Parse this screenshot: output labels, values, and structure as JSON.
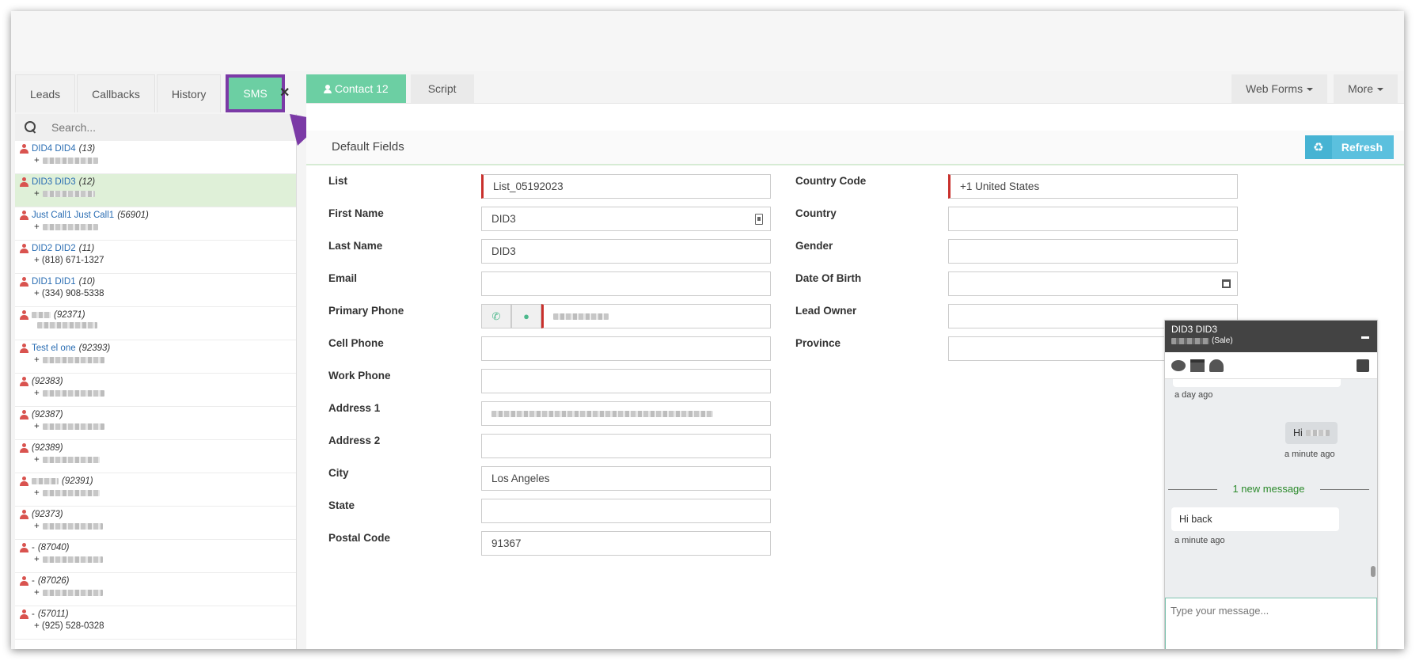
{
  "left_tabs": [
    "Leads",
    "Callbacks",
    "History",
    "SMS"
  ],
  "search": {
    "placeholder": "Search..."
  },
  "leads": [
    {
      "name": "DID4 DID4",
      "id": "(13)",
      "phone": "+"
    },
    {
      "name": "DID3 DID3",
      "id": "(12)",
      "phone": "+"
    },
    {
      "name": "Just Call1 Just Call1",
      "id": "(56901)",
      "phone": "+"
    },
    {
      "name": "DID2 DID2",
      "id": "(11)",
      "phone": "+ (818) 671-1327"
    },
    {
      "name": "DID1 DID1",
      "id": "(10)",
      "phone": "+ (334) 908-5338"
    },
    {
      "name": "",
      "id": "(92371)",
      "phone": ""
    },
    {
      "name": "Test el one",
      "id": "(92393)",
      "phone": "+"
    },
    {
      "name": "",
      "id": "(92383)",
      "phone": "+"
    },
    {
      "name": "",
      "id": "(92387)",
      "phone": "+"
    },
    {
      "name": "",
      "id": "(92389)",
      "phone": "+"
    },
    {
      "name": "",
      "id": "(92391)",
      "phone": "+"
    },
    {
      "name": "",
      "id": "(92373)",
      "phone": "+"
    },
    {
      "name": "-",
      "id": "(87040)",
      "phone": "+"
    },
    {
      "name": "-",
      "id": "(87026)",
      "phone": "+"
    },
    {
      "name": "-",
      "id": "(57011)",
      "phone": "+ (925) 528-0328"
    }
  ],
  "main_tabs": {
    "contact": "Contact 12",
    "script": "Script",
    "web_forms": "Web Forms",
    "more": "More"
  },
  "section": {
    "title": "Default Fields",
    "refresh": "Refresh"
  },
  "fields_left": [
    {
      "label": "List",
      "value": "List_05192023"
    },
    {
      "label": "First Name",
      "value": "DID3"
    },
    {
      "label": "Last Name",
      "value": "DID3"
    },
    {
      "label": "Email",
      "value": ""
    },
    {
      "label": "Primary Phone",
      "value": ""
    },
    {
      "label": "Cell Phone",
      "value": ""
    },
    {
      "label": "Work Phone",
      "value": ""
    },
    {
      "label": "Address 1",
      "value": ""
    },
    {
      "label": "Address 2",
      "value": ""
    },
    {
      "label": "City",
      "value": "Los Angeles"
    },
    {
      "label": "State",
      "value": ""
    },
    {
      "label": "Postal Code",
      "value": "91367"
    }
  ],
  "fields_right": [
    {
      "label": "Country Code",
      "value": "+1 United States"
    },
    {
      "label": "Country",
      "value": ""
    },
    {
      "label": "Gender",
      "value": ""
    },
    {
      "label": "Date Of Birth",
      "value": ""
    },
    {
      "label": "Lead Owner",
      "value": ""
    },
    {
      "label": "Province",
      "value": ""
    }
  ],
  "chat": {
    "name": "DID3 DID3",
    "status": "(Sale)",
    "msg1_time": "a day ago",
    "msg2_text": "Hi",
    "msg2_time": "a minute ago",
    "divider": "1 new message",
    "msg3_text": "Hi back",
    "msg3_time": "a minute ago",
    "input_placeholder": "Type your message..."
  }
}
